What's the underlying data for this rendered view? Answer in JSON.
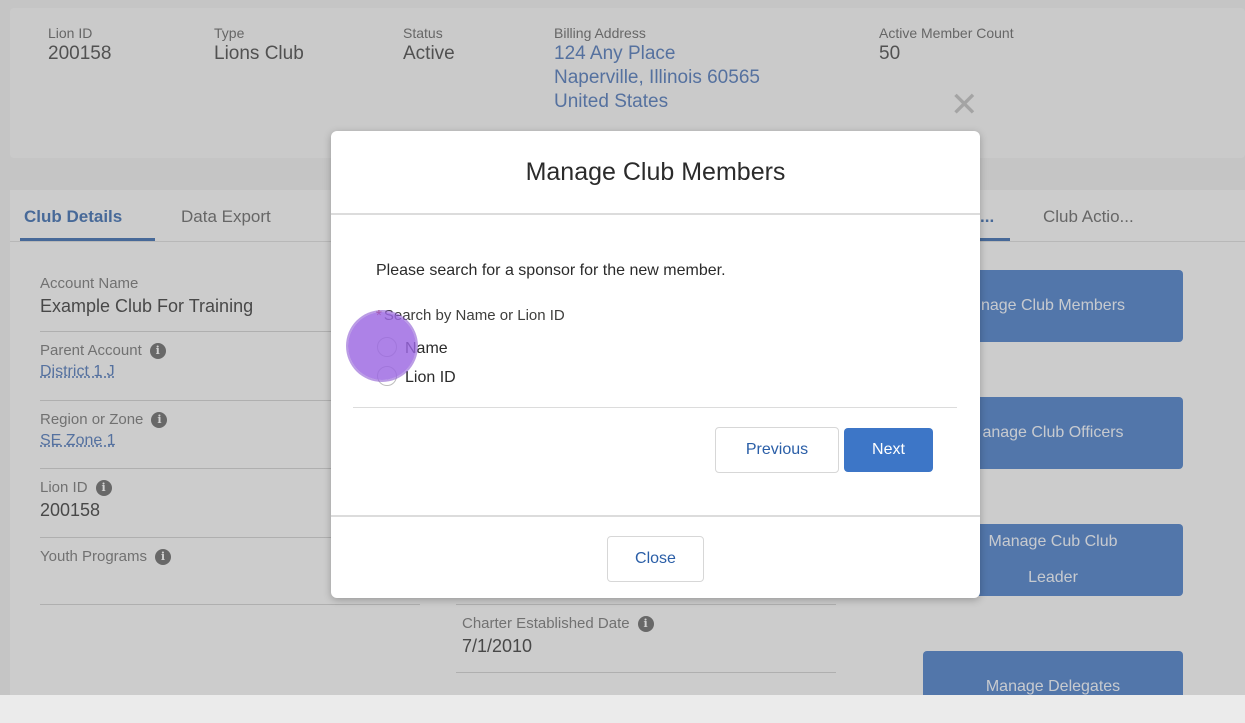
{
  "highlights": {
    "lion_id": {
      "label": "Lion ID",
      "value": "200158"
    },
    "type": {
      "label": "Type",
      "value": "Lions Club"
    },
    "status": {
      "label": "Status",
      "value": "Active"
    },
    "billing_address": {
      "label": "Billing Address",
      "line1": "124 Any Place",
      "line2": "Naperville, Illinois 60565",
      "line3": "United States"
    },
    "active_member_count": {
      "label": "Active Member Count",
      "value": "50"
    },
    "close_glyph": "✕"
  },
  "tabs": {
    "club_details": "Club Details",
    "data_export": "Data Export",
    "truncated_tab": "...",
    "club_actions": "Club Actio..."
  },
  "details": {
    "account_name": {
      "label": "Account Name",
      "value": "Example Club For Training"
    },
    "parent_account": {
      "label": "Parent Account",
      "value": "District 1 J"
    },
    "region_zone": {
      "label": "Region or Zone",
      "value": "SE Zone 1"
    },
    "lion_id": {
      "label": "Lion ID",
      "value": "200158"
    },
    "youth_programs": {
      "label": "Youth Programs"
    },
    "charter_date": {
      "label": "Charter Established Date",
      "value": "7/1/2010"
    },
    "info_glyph": "i"
  },
  "actions": {
    "manage_members": "nage Club Members",
    "manage_officers": "anage Club Officers",
    "manage_cub_leader_line1": "Manage Cub Club",
    "manage_cub_leader_line2": "Leader",
    "manage_delegates": "Manage Delegates"
  },
  "modal": {
    "title": "Manage Club Members",
    "instruction": "Please search for a sponsor for the new member.",
    "required_marker": "*",
    "search_label": "Search by Name or Lion ID",
    "options": [
      "Name",
      "Lion ID"
    ],
    "previous": "Previous",
    "next": "Next",
    "close": "Close"
  },
  "colors": {
    "brand_blue": "#3b72c2",
    "link_blue": "#406bb1",
    "click_indicator": "#9b66e2",
    "required": "#c23934"
  }
}
